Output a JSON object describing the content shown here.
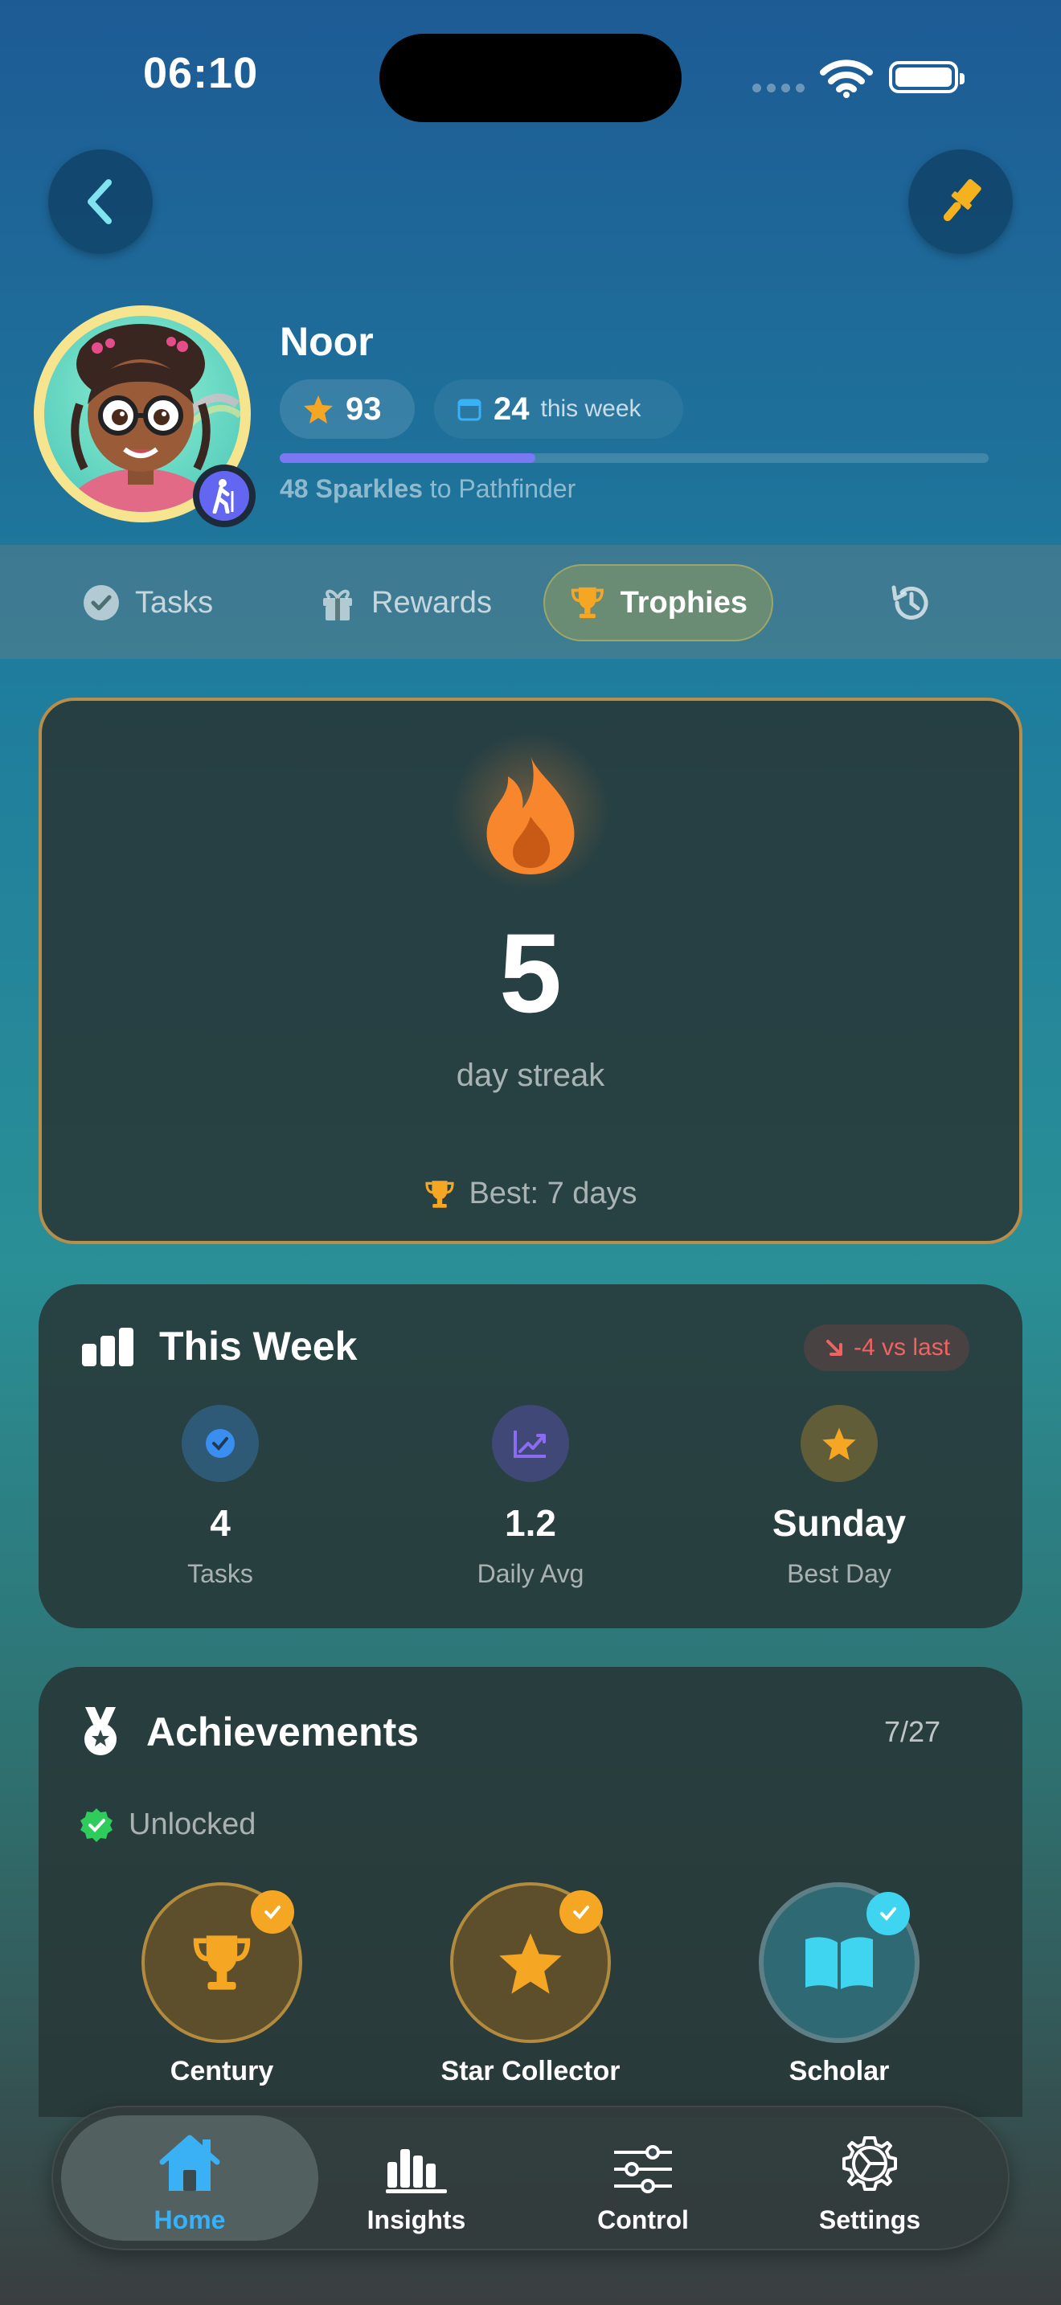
{
  "status_bar": {
    "time": "06:10"
  },
  "profile": {
    "name": "Noor",
    "stars": "93",
    "weekly_count": "24",
    "weekly_label": "this week",
    "progress_fraction": 0.36,
    "sparkles_amount": "48 Sparkles",
    "sparkles_target": "to Pathfinder"
  },
  "tabs": [
    {
      "label": "Tasks"
    },
    {
      "label": "Rewards"
    },
    {
      "label": "Trophies"
    },
    {
      "label": ""
    }
  ],
  "streak": {
    "value": "5",
    "label": "day streak",
    "best": "Best: 7 days"
  },
  "week": {
    "title": "This Week",
    "delta": "-4 vs last",
    "stats": [
      {
        "value": "4",
        "label": "Tasks"
      },
      {
        "value": "1.2",
        "label": "Daily Avg"
      },
      {
        "value": "Sunday",
        "label": "Best Day"
      }
    ]
  },
  "achievements": {
    "title": "Achievements",
    "count": "7/27",
    "section_label": "Unlocked",
    "items": [
      {
        "label": "Century",
        "icon": "trophy-icon"
      },
      {
        "label": "Star Collector",
        "icon": "star-icon"
      },
      {
        "label": "Scholar",
        "icon": "book-icon"
      }
    ]
  },
  "bottom_nav": [
    {
      "label": "Home",
      "icon": "home-icon"
    },
    {
      "label": "Insights",
      "icon": "bar-chart-icon"
    },
    {
      "label": "Control",
      "icon": "sliders-icon"
    },
    {
      "label": "Settings",
      "icon": "gear-icon"
    }
  ],
  "colors": {
    "accent_blue": "#3ab0f5",
    "gold": "#f5a623",
    "flame": "#f7862c",
    "streak_border": "#b98d4a",
    "negative": "#f06363",
    "progress": "#7a78f2"
  }
}
